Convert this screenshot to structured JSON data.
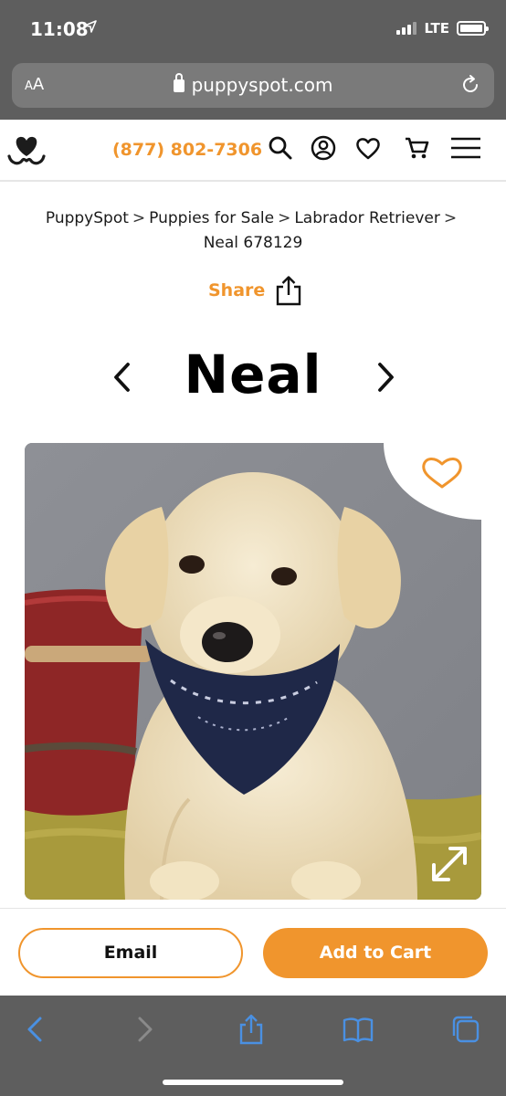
{
  "status_bar": {
    "time": "11:08",
    "network": "LTE"
  },
  "browser": {
    "text_size_label_small": "A",
    "text_size_label_large": "A",
    "url": "puppyspot.com"
  },
  "header": {
    "phone": "(877) 802-7306"
  },
  "breadcrumb": {
    "items": [
      "PuppySpot",
      "Puppies for Sale",
      "Labrador Retriever",
      "Neal 678129"
    ],
    "separator": ">"
  },
  "share": {
    "label": "Share"
  },
  "puppy": {
    "name": "Neal"
  },
  "actions": {
    "email_label": "Email",
    "cart_label": "Add to Cart"
  },
  "colors": {
    "brand_orange": "#f0952d",
    "safari_gray": "#5e5e5e",
    "safari_blue": "#4a90e2"
  },
  "icons": [
    "location-arrow-icon",
    "signal-icon",
    "battery-icon",
    "lock-icon",
    "reload-icon",
    "puppyspot-logo-icon",
    "search-icon",
    "account-icon",
    "heart-icon",
    "cart-icon",
    "menu-icon",
    "share-icon",
    "chevron-left-icon",
    "chevron-right-icon",
    "favorite-heart-icon",
    "expand-icon",
    "back-icon",
    "forward-icon",
    "share-sheet-icon",
    "bookmarks-icon",
    "tabs-icon"
  ]
}
